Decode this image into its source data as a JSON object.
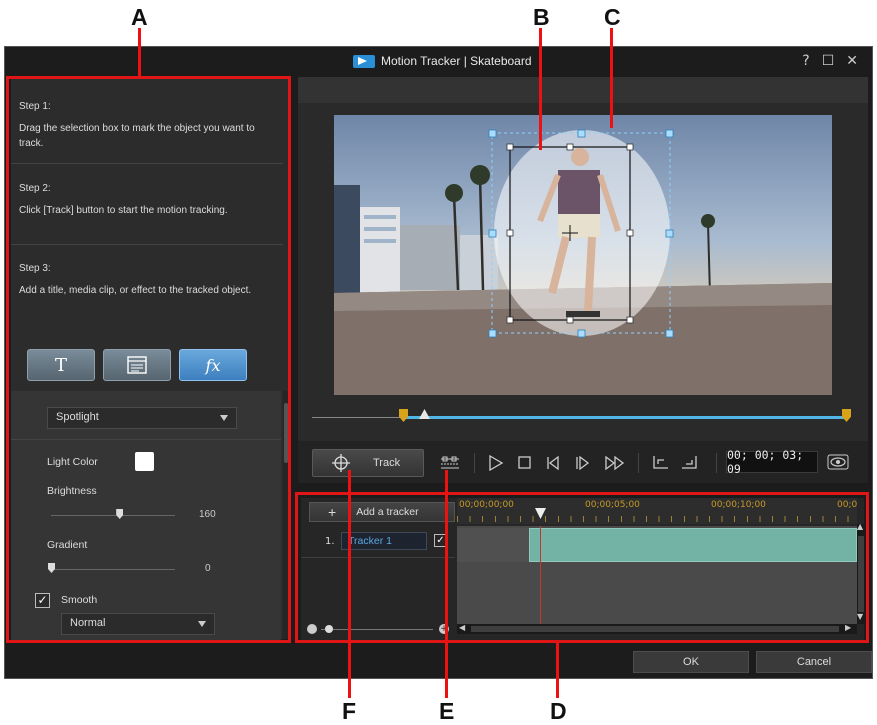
{
  "callouts": {
    "a": "A",
    "b": "B",
    "c": "C",
    "d": "D",
    "e": "E",
    "f": "F"
  },
  "window": {
    "title": "Motion Tracker  |  Skateboard",
    "help": "?",
    "maximize": "☐",
    "close": "✕"
  },
  "steps": [
    {
      "heading": "Step 1:",
      "text": "Drag the selection box to mark the object you want to track."
    },
    {
      "heading": "Step 2:",
      "text": "Click [Track] button to start the motion tracking."
    },
    {
      "heading": "Step 3:",
      "text": "Add a title, media clip, or effect to the tracked object."
    }
  ],
  "attach_buttons": {
    "title": "T",
    "fx": "fx"
  },
  "effect": {
    "selected": "Spotlight",
    "light_color_label": "Light Color",
    "brightness_label": "Brightness",
    "brightness_value": "160",
    "brightness_level": 0.55,
    "gradient_label": "Gradient",
    "gradient_value": "0",
    "gradient_level": 0,
    "smooth_label": "Smooth",
    "smooth_checked": true,
    "smooth_mode": "Normal"
  },
  "controls": {
    "track_label": "Track",
    "timecode": "00; 00; 03; 09"
  },
  "timeline": {
    "add_tracker_label": "Add a tracker",
    "ruler": [
      "00;00;00;00",
      "00;00;05;00",
      "00;00;10;00",
      "00;0"
    ],
    "tracker_index": "1.",
    "tracker_name": "Tracker 1"
  },
  "footer": {
    "ok": "OK",
    "cancel": "Cancel"
  },
  "colors": {
    "callout_red": "#e01515",
    "accent_blue": "#4fb6e6",
    "clip_teal": "#72b3a6"
  }
}
